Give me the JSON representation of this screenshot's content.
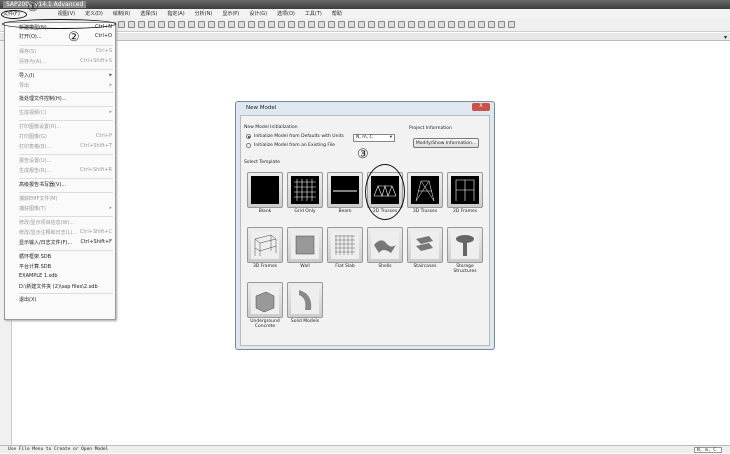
{
  "app": {
    "title": "SAP2000 v14.1 Advanced"
  },
  "menubar": [
    "文件(F)",
    "视图(V)",
    "定义(D)",
    "绘制(R)",
    "选择(S)",
    "指定(A)",
    "分析(N)",
    "显示(P)",
    "设计(G)",
    "选项(O)",
    "工具(T)",
    "帮助"
  ],
  "file_menu": [
    {
      "label": "新建模型(N)...",
      "shortcut": "Ctrl+N"
    },
    {
      "label": "打开(O)...",
      "shortcut": "Ctrl+O"
    },
    {
      "label": "保存(S)",
      "shortcut": "Ctrl+S",
      "disabled": true
    },
    {
      "label": "另存为(A)...",
      "shortcut": "Ctrl+Shift+S",
      "disabled": true
    },
    {
      "label": "导入(I)",
      "shortcut": "▸"
    },
    {
      "label": "导出",
      "shortcut": "▸",
      "disabled": true
    },
    {
      "label": "批处理文件控制(H)...",
      "shortcut": ""
    },
    {
      "label": "生成视频(C)",
      "shortcut": "▸",
      "disabled": true
    },
    {
      "label": "打印图像设置(R)...",
      "shortcut": "",
      "disabled": true
    },
    {
      "label": "打印图像(G)",
      "shortcut": "Ctrl+P",
      "disabled": true
    },
    {
      "label": "打印表格(B)...",
      "shortcut": "Ctrl+Shift+T",
      "disabled": true
    },
    {
      "label": "报告设置(U)...",
      "shortcut": "",
      "disabled": true
    },
    {
      "label": "生成报告(R)...",
      "shortcut": "Ctrl+Shift+R",
      "disabled": true
    },
    {
      "label": "高级报告书写器(V)...",
      "shortcut": ""
    },
    {
      "label": "捕获EMF文件(M)",
      "shortcut": "",
      "disabled": true
    },
    {
      "label": "捕获图像(T)",
      "shortcut": "▸",
      "disabled": true
    },
    {
      "label": "修改/显示项目信息(W)...",
      "shortcut": "",
      "disabled": true
    },
    {
      "label": "修改/显示注释和日志(L)...",
      "shortcut": "Ctrl+Shift+C",
      "disabled": true
    },
    {
      "label": "显示输入/日志文件(F)...",
      "shortcut": "Ctrl+Shift+F"
    },
    {
      "label": "循环框架.SDB",
      "shortcut": ""
    },
    {
      "label": "平台计算.SDB",
      "shortcut": ""
    },
    {
      "label": "EXAMPLE 1.sdb",
      "shortcut": ""
    },
    {
      "label": "D:\\新建文件夹 (2)\\sap files\\2.sdb",
      "shortcut": ""
    },
    {
      "label": "退出(X)",
      "shortcut": ""
    }
  ],
  "annotations": [
    "①",
    "②",
    "③"
  ],
  "dialog": {
    "title": "New Model",
    "close": "X",
    "init_label": "New Model Initialization",
    "radio_defaults": "Initialize Model from Defaults with Units",
    "radio_file": "Initialize Model from an Existing File",
    "units": "N, m, C",
    "project_label": "Project Information",
    "project_button": "Modify/Show Information...",
    "template_label": "Select Template",
    "templates": [
      "Blank",
      "Grid Only",
      "Beam",
      "2D Trusses",
      "3D Trusses",
      "2D Frames",
      "3D Frames",
      "Wall",
      "Flat Slab",
      "Shells",
      "Staircases",
      "Storage Structures",
      "Underground Concrete",
      "Solid Models"
    ]
  },
  "status": {
    "text": "Use File Menu to Create or Open Model",
    "units": "N, m, C"
  }
}
